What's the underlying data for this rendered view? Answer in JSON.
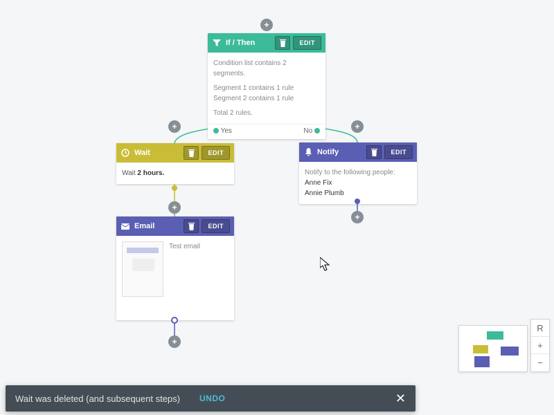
{
  "nodes": {
    "ifthen": {
      "title": "If / Then",
      "line1": "Condition list contains 2 segments.",
      "line2": "Segment 1 contains 1 rule",
      "line3": "Segment 2 contains 1 rule",
      "line4": "Total 2 rules.",
      "yes": "Yes",
      "no": "No",
      "edit": "EDIT"
    },
    "wait": {
      "title": "Wait",
      "body_prefix": "Wait ",
      "body_value": "2 hours.",
      "edit": "EDIT"
    },
    "notify": {
      "title": "Notify",
      "intro": "Notify to the following people:",
      "p1": "Anne Fix",
      "p2": "Annie Plumb",
      "edit": "EDIT"
    },
    "email": {
      "title": "Email",
      "body": "Test email",
      "edit": "EDIT"
    }
  },
  "toast": {
    "message": "Wait was deleted (and subsequent steps)",
    "undo": "UNDO"
  },
  "zoom": {
    "reset": "R",
    "in": "+",
    "out": "−"
  }
}
